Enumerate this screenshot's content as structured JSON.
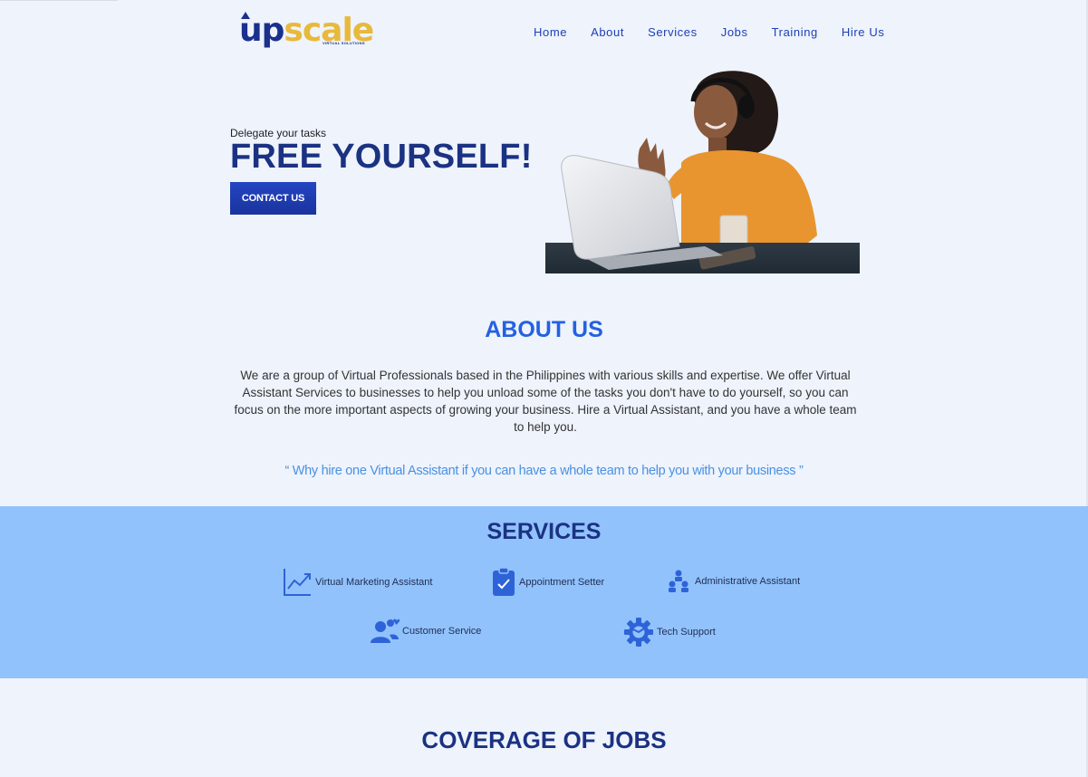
{
  "header": {
    "logo": {
      "part1": "up",
      "part2": "scale",
      "tagline": "VIRTUAL SOLUTIONS"
    },
    "nav": [
      "Home",
      "About",
      "Services",
      "Jobs",
      "Training",
      "Hire Us"
    ]
  },
  "hero": {
    "subtitle": "Delegate your tasks",
    "title": "FREE YOURSELF!",
    "cta_label": "CONTACT US",
    "image": "woman-with-headset-waving-at-laptop"
  },
  "about": {
    "title": "ABOUT US",
    "text": "We are a group of Virtual Professionals based in the Philippines with various skills and expertise. We offer Virtual Assistant Services to businesses to help you unload some of the tasks you don't have to do yourself, so you can focus on the more important aspects of growing your business. Hire a Virtual Assistant, and you have a whole team to help you.",
    "quote": "“ Why hire one Virtual Assistant if you can have a whole team to help you with your business ”"
  },
  "services": {
    "title": "SERVICES",
    "items": [
      {
        "label": "Virtual Marketing Assistant",
        "icon": "trend-chart-icon"
      },
      {
        "label": "Appointment Setter",
        "icon": "clipboard-check-icon"
      },
      {
        "label": "Administrative Assistant",
        "icon": "org-chart-icon"
      },
      {
        "label": "Customer Service",
        "icon": "people-heart-icon"
      },
      {
        "label": "Tech Support",
        "icon": "gear-icon"
      }
    ]
  },
  "coverage": {
    "title": "COVERAGE OF JOBS"
  },
  "colors": {
    "page_bg": "#eef3fc",
    "brand_navy": "#1b3282",
    "brand_gold": "#e8b93a",
    "accent_blue": "#2561e0",
    "services_bg": "#91c2fb"
  }
}
